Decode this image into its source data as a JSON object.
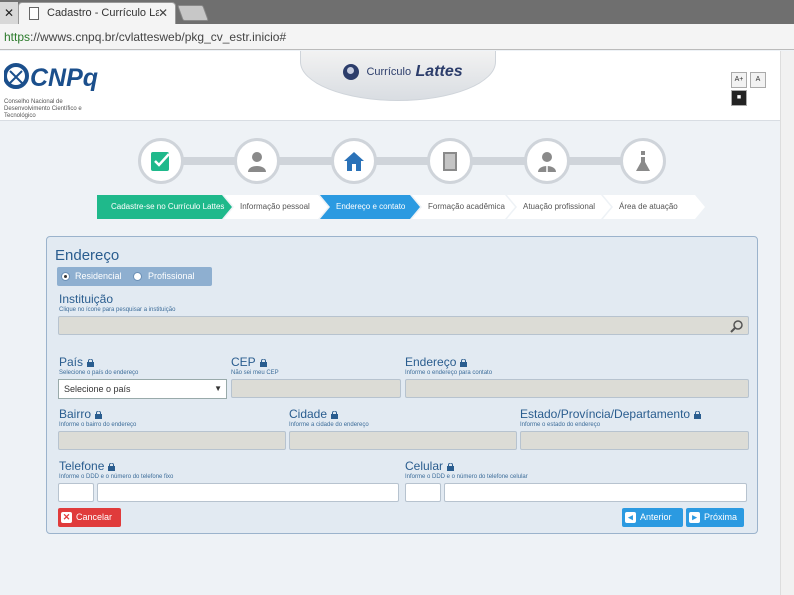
{
  "browser": {
    "tab_title": "Cadastro - Currículo Lattes",
    "url_scheme": "https",
    "url_rest": "://wwws.cnpq.br/cvlattesweb/pkg_cv_estr.inicio#"
  },
  "header": {
    "logo_text": "CNPq",
    "logo_subtitle": "Conselho Nacional de Desenvolvimento Científico e Tecnológico",
    "banner_small": "Currículo",
    "banner_big": "Lattes",
    "font_buttons": [
      "A+",
      "A",
      "■"
    ]
  },
  "steps": {
    "icons": [
      "checklist-icon",
      "person-icon",
      "home-icon",
      "book-icon",
      "worker-icon",
      "flask-icon"
    ],
    "labels": [
      "Cadastre-se no Currículo Lattes",
      "Informação pessoal",
      "Endereço e contato",
      "Formação acadêmica",
      "Atuação profissional",
      "Área de atuação"
    ]
  },
  "form": {
    "title": "Endereço",
    "radio_residencial": "Residencial",
    "radio_profissional": "Profissional",
    "instituicao_label": "Instituição",
    "instituicao_hint": "Clique no ícone para pesquisar a instituição",
    "pais_label": "País",
    "pais_hint": "Selecione o país do endereço",
    "pais_value": "Selecione o país",
    "cep_label": "CEP",
    "cep_hint": "Não sei meu CEP",
    "endereco_label": "Endereço",
    "endereco_hint": "Informe o endereço para contato",
    "bairro_label": "Bairro",
    "bairro_hint": "Informe o bairro do endereço",
    "cidade_label": "Cidade",
    "cidade_hint": "Informe a cidade do endereço",
    "estado_label": "Estado/Província/Departamento",
    "estado_hint": "Informe o estado do endereço",
    "telefone_label": "Telefone",
    "telefone_hint": "Informe o DDD e o número do telefone fixo",
    "celular_label": "Celular",
    "celular_hint": "Informe o DDD e o número do telefone celular",
    "cancel_label": "Cancelar",
    "prev_label": "Anterior",
    "next_label": "Próxima"
  },
  "colors": {
    "done_step": "#1fb98b",
    "active_step": "#2b9ae1",
    "cancel": "#e03b3b"
  }
}
